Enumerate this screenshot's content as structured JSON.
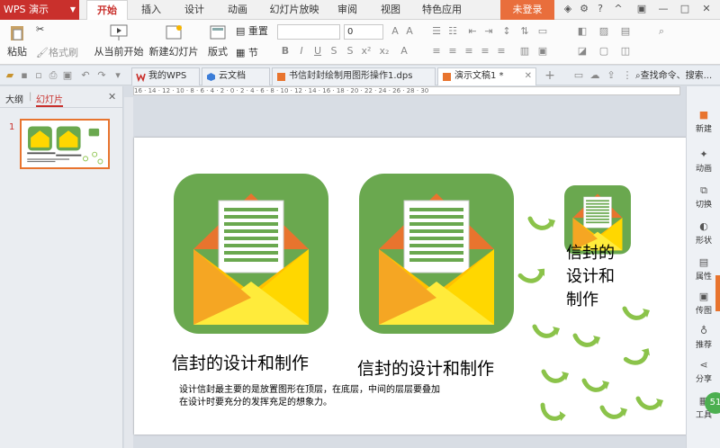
{
  "titlebar": {
    "app_name": "WPS 演示",
    "menu_tabs": [
      "开始",
      "插入",
      "设计",
      "动画",
      "幻灯片放映",
      "审阅",
      "视图",
      "特色应用"
    ],
    "login": "未登录"
  },
  "ribbon": {
    "paste": "粘贴",
    "format_painter": "格式刷",
    "from_current": "从当前开始",
    "new_slide": "新建幻灯片",
    "layout": "版式",
    "reset": "重置",
    "section": "节",
    "font_size": "0"
  },
  "doc_tabs": [
    {
      "label": "我的WPS",
      "active": false
    },
    {
      "label": "云文档",
      "active": false
    },
    {
      "label": "书信封封绘制用图形操作1.dps",
      "active": false
    },
    {
      "label": "演示文稿1 *",
      "active": true
    }
  ],
  "search": {
    "placeholder": "查找命令、搜索..."
  },
  "left_panel": {
    "tab_outline": "大纲",
    "tab_slides": "幻灯片",
    "slide_number": "1"
  },
  "ruler_text": "16 · 14 · 12 · 10 · 8 · 6 · 4 · 2 · 0 · 2 · 4 · 6 · 8 · 10 · 12 · 14 · 16 · 18 · 20 · 22 · 24 · 26 · 28 · 30",
  "slide": {
    "caption1": "信封的设计和制作",
    "caption2": "信封的设计和制作",
    "caption3_line1": "信封",
    "caption3_line2": "的",
    "caption3_full": [
      "信封的",
      "设计和",
      "制作"
    ],
    "body_line1": "设计信封最主要的是放置图形在顶层，在底层，中间的层层要叠加",
    "body_line2": "在设计时要充分的发挥充足的想象力。"
  },
  "right_bar": [
    "新建",
    "动画",
    "切换",
    "形状",
    "属性",
    "传图",
    "推荐",
    "分享",
    "工具"
  ],
  "badge": "51",
  "colors": {
    "accent": "#c9302c",
    "icon_bg": "#6aa84f",
    "envelope_yellow": "#ffd700",
    "envelope_orange": "#f5a623",
    "paper_lines": "#6aa84f"
  }
}
